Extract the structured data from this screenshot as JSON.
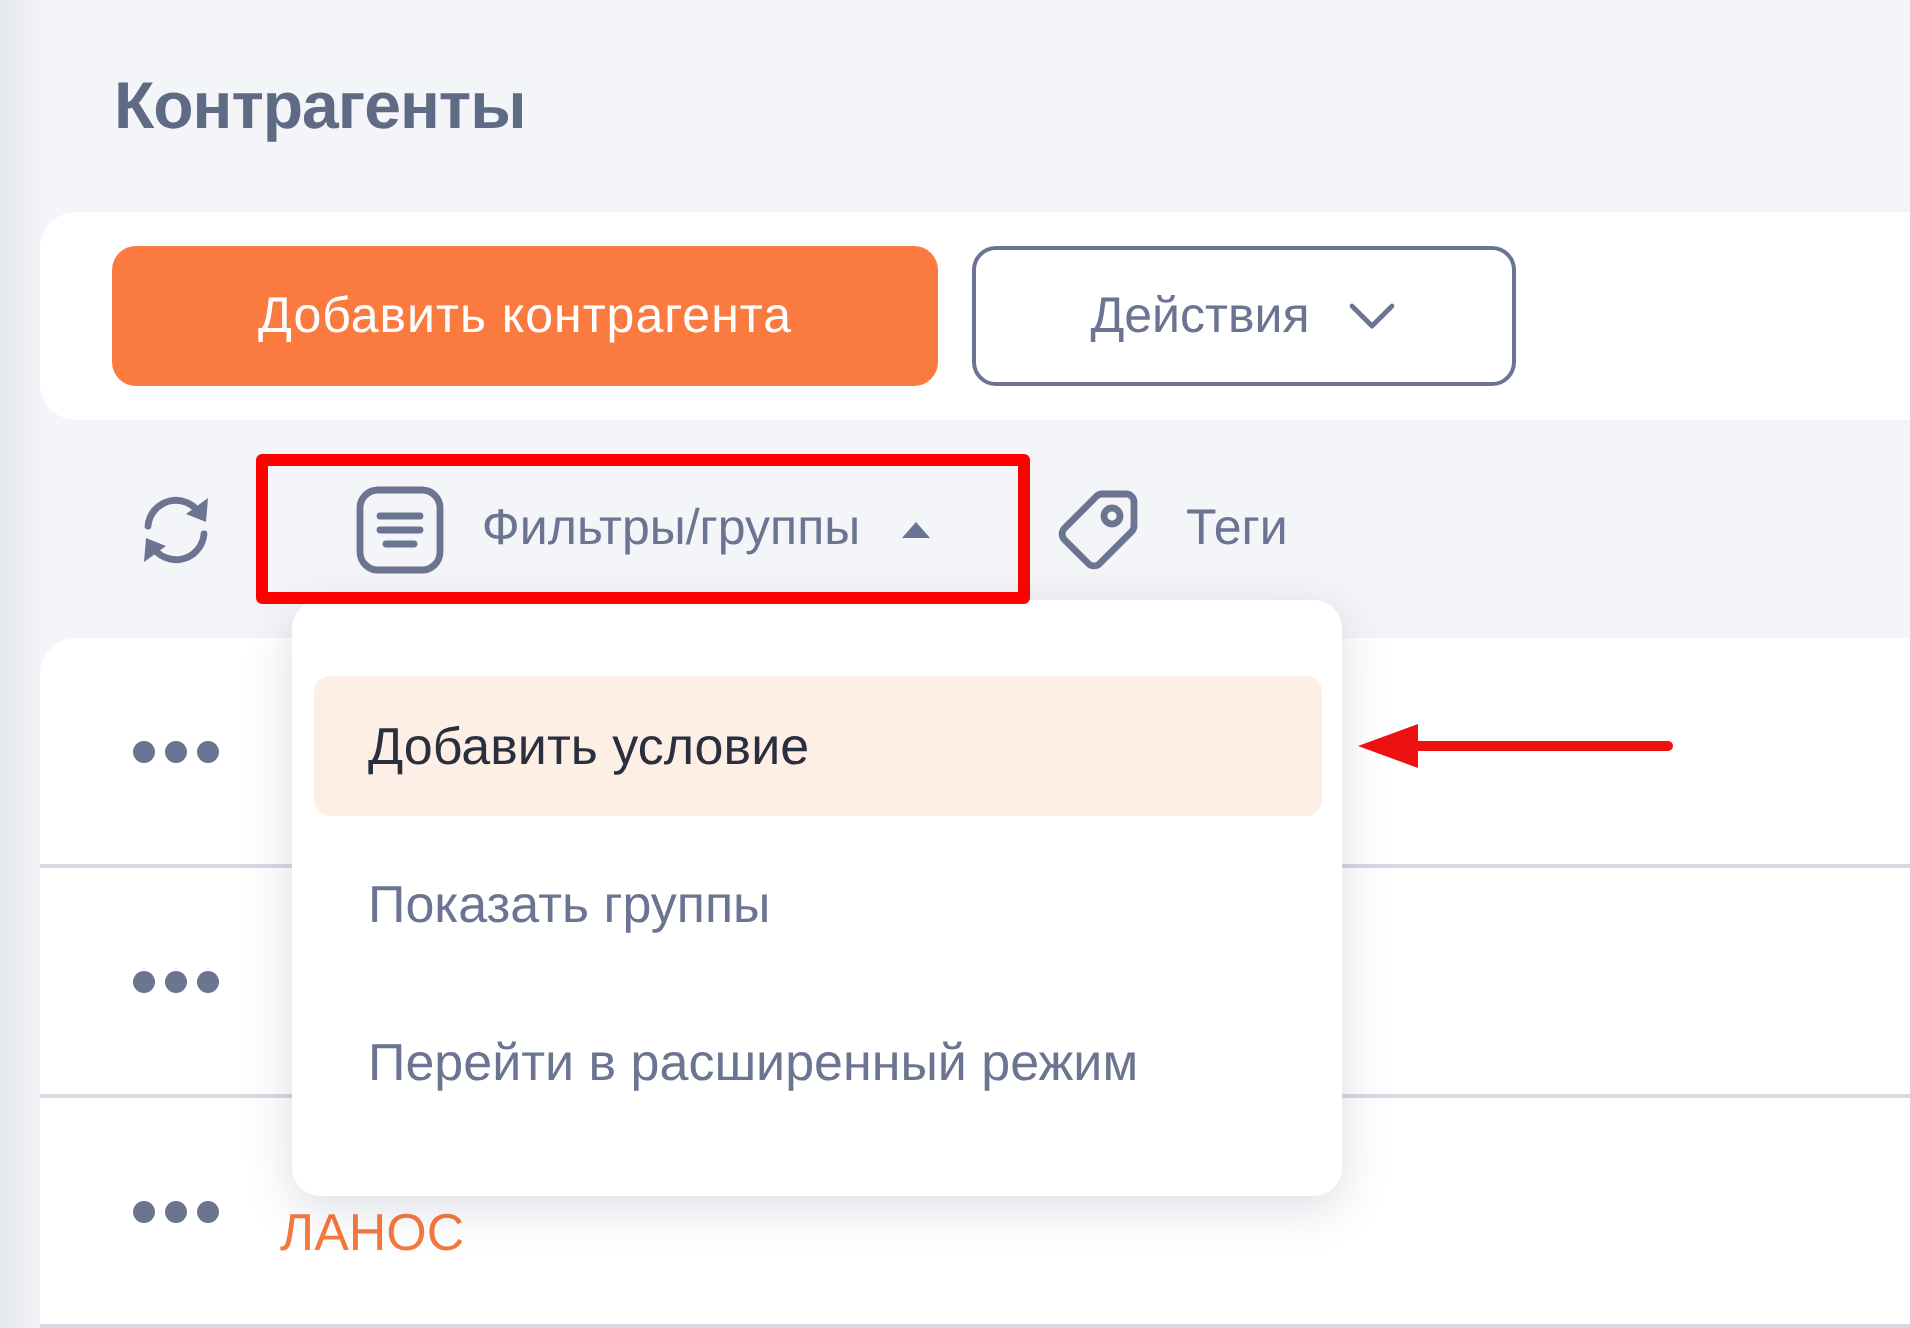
{
  "page_title": "Контрагенты",
  "header_actions": {
    "primary_button": "Добавить контрагента",
    "actions_button": "Действия"
  },
  "toolbar": {
    "filters": {
      "label": "Фильтры/группы",
      "expanded": true
    },
    "tags": {
      "label": "Теги"
    }
  },
  "rows": [
    {},
    {},
    {
      "name": "ЛАНОС"
    }
  ],
  "filter_menu": [
    {
      "label": "Добавить условие",
      "selected": true
    },
    {
      "label": "Показать группы",
      "selected": false
    },
    {
      "label": "Перейти в расширенный режим",
      "selected": false
    }
  ],
  "annotations": {
    "highlight_frame": true,
    "pointer_arrow": true
  }
}
